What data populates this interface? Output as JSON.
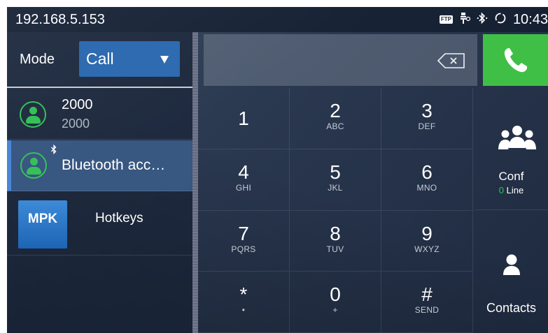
{
  "status_bar": {
    "ip_address": "192.168.5.153",
    "ftp_badge": "FTP",
    "time": "10:43",
    "icons": [
      "ftp-icon",
      "usb-icon",
      "bluetooth-icon",
      "sync-icon"
    ]
  },
  "left_panel": {
    "mode_label": "Mode",
    "mode_value": "Call",
    "accounts": [
      {
        "title": "2000",
        "subtitle": "2000",
        "icon": "account-icon"
      },
      {
        "title": "Bluetooth acc…",
        "icon": "account-icon",
        "badge_icon": "bluetooth-icon",
        "selected": true
      }
    ],
    "hotkeys": {
      "tile_text": "MPK",
      "label": "Hotkeys"
    }
  },
  "dialer": {
    "number_value": "",
    "keys": [
      {
        "digit": "1",
        "letters": ""
      },
      {
        "digit": "2",
        "letters": "ABC"
      },
      {
        "digit": "3",
        "letters": "DEF"
      },
      {
        "digit": "4",
        "letters": "GHI"
      },
      {
        "digit": "5",
        "letters": "JKL"
      },
      {
        "digit": "6",
        "letters": "MNO"
      },
      {
        "digit": "7",
        "letters": "PQRS"
      },
      {
        "digit": "8",
        "letters": "TUV"
      },
      {
        "digit": "9",
        "letters": "WXYZ"
      },
      {
        "digit": "*",
        "letters": "•"
      },
      {
        "digit": "0",
        "letters": "+"
      },
      {
        "digit": "#",
        "letters": "SEND"
      }
    ],
    "conf": {
      "label": "Conf",
      "count": "0",
      "count_suffix": " Line"
    },
    "contacts": {
      "label": "Contacts"
    }
  },
  "colors": {
    "call_green": "#3fbf46",
    "accent_blue": "#2e6bb0",
    "account_green": "#37c05a"
  }
}
